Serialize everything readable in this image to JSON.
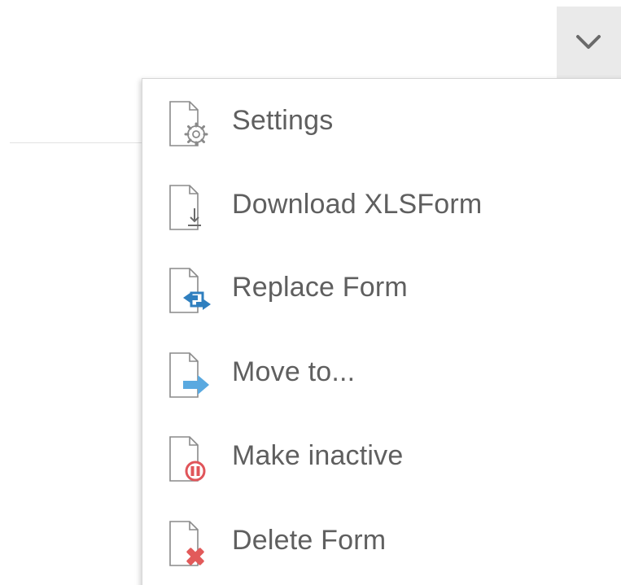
{
  "toggle": {
    "icon": "chevron-down-icon"
  },
  "menu": {
    "items": [
      {
        "label": "Settings",
        "icon": "settings-icon"
      },
      {
        "label": "Download XLSForm",
        "icon": "download-icon"
      },
      {
        "label": "Replace Form",
        "icon": "replace-icon"
      },
      {
        "label": "Move to...",
        "icon": "move-icon"
      },
      {
        "label": "Make inactive",
        "icon": "pause-icon"
      },
      {
        "label": "Delete Form",
        "icon": "delete-icon"
      }
    ]
  },
  "colors": {
    "label_text": "#5f5f5f",
    "icon_outline": "#8a8a8a",
    "replace_blue": "#2f7fbf",
    "move_blue": "#5aa9e0",
    "inactive_red": "#e0555a",
    "delete_red": "#e25a5a",
    "toggle_bg": "#eaeaea"
  }
}
